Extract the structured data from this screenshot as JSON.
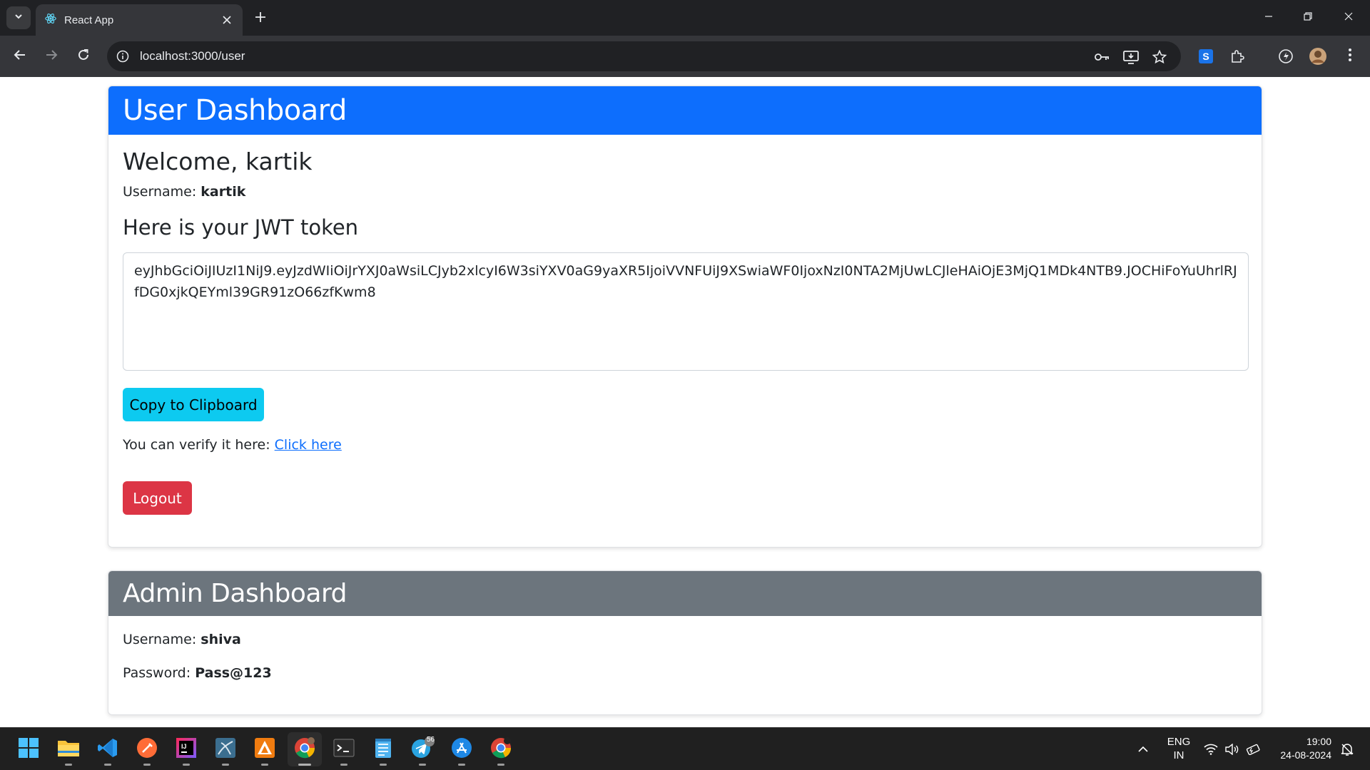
{
  "browser": {
    "tab_title": "React App",
    "url": "localhost:3000/user"
  },
  "user_dashboard": {
    "header": "User Dashboard",
    "welcome_prefix": "Welcome, ",
    "welcome_name": "kartik",
    "username_label": "Username: ",
    "username_value": "kartik",
    "jwt_heading": "Here is your JWT token",
    "token": "eyJhbGciOiJIUzI1NiJ9.eyJzdWIiOiJrYXJ0aWsiLCJyb2xlcyI6W3siYXV0aG9yaXR5IjoiVVNFUiJ9XSwiaWF0IjoxNzI0NTA2MjUwLCJleHAiOjE3MjQ1MDk4NTB9.JOCHiFoYuUhrlRJfDG0xjkQEYml39GR91zO66zfKwm8",
    "copy_button": "Copy to Clipboard",
    "verify_text": "You can verify it here: ",
    "verify_link": "Click here",
    "logout_button": "Logout"
  },
  "admin_dashboard": {
    "header": "Admin Dashboard",
    "username_label": "Username: ",
    "username_value": "shiva",
    "password_label": "Password: ",
    "password_value": "Pass@123"
  },
  "taskbar": {
    "language_line1": "ENG",
    "language_line2": "IN",
    "time": "19:00",
    "date": "24-08-2024",
    "telegram_badge": "56"
  },
  "colors": {
    "primary": "#0d6efd",
    "secondary": "#6c757d",
    "info": "#0dcaf0",
    "danger": "#dc3545"
  }
}
